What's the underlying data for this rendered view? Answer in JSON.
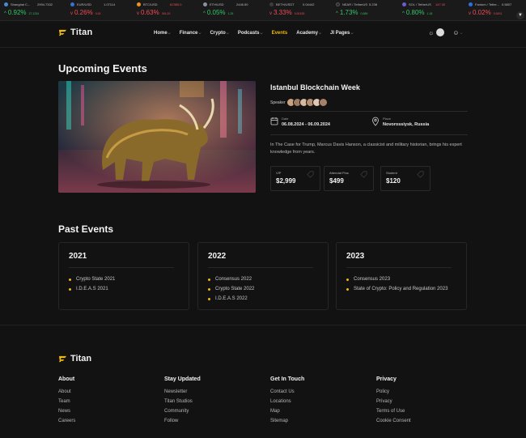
{
  "ticker": [
    {
      "name": "Shanghai C...",
      "price": "2994.7332",
      "pct": "0.92%",
      "change": "27.1234",
      "dir": "up",
      "color": "#4b8bd6"
    },
    {
      "name": "EUR/USD",
      "price": "1.07114",
      "pct": "0.26%",
      "change": "0.00",
      "dir": "down",
      "color": "#3b6fd4"
    },
    {
      "name": "BTC/USD",
      "price": "62385.0",
      "pct": "0.63%",
      "change": "391.00",
      "dir": "down",
      "color": "#f0931b"
    },
    {
      "name": "ETH/USD",
      "price": "2446.50",
      "pct": "0.05%",
      "change": "1.25",
      "dir": "up",
      "color": "#8a8fa3"
    },
    {
      "name": "BETH/USDT",
      "price": "0.04442",
      "pct": "3.33%",
      "change": "0.00153",
      "dir": "down",
      "color": "#3c3c3c"
    },
    {
      "name": "NEAR / TetherUS",
      "price": "5.238",
      "pct": "1.73%",
      "change": "0.089",
      "dir": "up",
      "color": "#2e2e2e"
    },
    {
      "name": "SOL / TetherUS",
      "price": "147.30",
      "pct": "0.80%",
      "change": "1.18",
      "dir": "up",
      "color": "#6b5bd6"
    },
    {
      "name": "Fantom / Tethe...",
      "price": "0.5807",
      "pct": "0.02%",
      "change": "0.0001",
      "dir": "down",
      "color": "#2f6fe0"
    }
  ],
  "brand": {
    "name": "Titan",
    "accent": "#f0b90b"
  },
  "nav": {
    "items": [
      {
        "label": "Home",
        "chevron": true,
        "active": false
      },
      {
        "label": "Finance",
        "chevron": true,
        "active": false
      },
      {
        "label": "Crypto",
        "chevron": true,
        "active": false
      },
      {
        "label": "Podcasts",
        "chevron": true,
        "active": false
      },
      {
        "label": "Events",
        "chevron": false,
        "active": true
      },
      {
        "label": "Academy",
        "chevron": true,
        "active": false
      },
      {
        "label": "JI Pages",
        "chevron": true,
        "active": false
      }
    ]
  },
  "upcoming": {
    "heading": "Upcoming Events",
    "event": {
      "title": "Istanbul Blockchain Week",
      "speaker_label": "Speaker",
      "date_label": "Date",
      "date_value": "06.08.2024 - 06.09.2024",
      "place_label": "Place",
      "place_value": "Novorossiysk, Russia",
      "description": "In The Case for Trump, Marcus Davis Hanson, a classicist and military historian, brings his expert knowledge from years.",
      "prices": [
        {
          "label": "VIP",
          "value": "$2,999"
        },
        {
          "label": "Attendat Plus",
          "value": "$499"
        },
        {
          "label": "Student",
          "value": "$120"
        }
      ]
    }
  },
  "past": {
    "heading": "Past Events",
    "years": [
      {
        "year": "2021",
        "items": [
          "Crypto State 2021",
          "I.D.E.A.S 2021"
        ]
      },
      {
        "year": "2022",
        "items": [
          "Consensus 2022",
          "Crypto State 2022",
          "I.D.E.A.S 2022"
        ]
      },
      {
        "year": "2023",
        "items": [
          "Consensus 2023",
          "State of Crypto: Policy and Regulation 2023"
        ]
      }
    ]
  },
  "footer": {
    "brand": "Titan",
    "columns": [
      {
        "title": "About",
        "links": [
          "About",
          "Team",
          "News",
          "Careers"
        ]
      },
      {
        "title": "Stay Updated",
        "links": [
          "Newsletter",
          "Titan Studios",
          "Community",
          "Follow"
        ]
      },
      {
        "title": "Get In Touch",
        "links": [
          "Contact Us",
          "Locations",
          "Map",
          "Sitemap"
        ]
      },
      {
        "title": "Privacy",
        "links": [
          "Policy",
          "Privacy",
          "Terms of Use",
          "Cookie Consent"
        ]
      }
    ]
  }
}
